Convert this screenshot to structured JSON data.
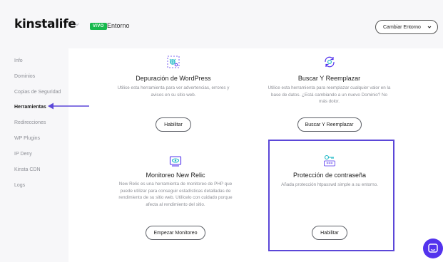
{
  "header": {
    "logo": "kinstalife",
    "env_badge": "VIVO",
    "env_label": "Entorno",
    "env_button": "Cambiar Entorno"
  },
  "sidebar": {
    "items": [
      {
        "label": "Info"
      },
      {
        "label": "Dominios"
      },
      {
        "label": "Copias de Seguridad"
      },
      {
        "label": "Herramientas",
        "active": true
      },
      {
        "label": "Redirecciones"
      },
      {
        "label": "WP Plugins"
      },
      {
        "label": "IP Deny"
      },
      {
        "label": "Kinsta CDN"
      },
      {
        "label": "Logs"
      }
    ]
  },
  "cards": [
    {
      "icon": "debug-bug-icon",
      "title": "Depuración de WordPress",
      "description": "Utilice esta herramienta para ver advertencias, errores y avisos en su sitio web.",
      "button": "Habilitar"
    },
    {
      "icon": "search-replace-icon",
      "title": "Buscar Y Reemplazar",
      "description": "Utilice esta herramienta para reemplazar cualquier valor en la base de datos. ¿Está cambiando a un nuevo Dominio? No más dolor.",
      "button": "Buscar Y Reemplazar"
    },
    {
      "icon": "monitor-eye-icon",
      "title": "Monitoreo New Relic",
      "description": "New Relic es una herramienta de monitoreo de PHP que puede utilizar para conseguir estadísticas detalladas de rendimiento de su sitio web. Utilícelo con cuidado porque afecta al rendimiento del sitio.",
      "button": "Empezar Monitoreo"
    },
    {
      "icon": "password-key-icon",
      "title": "Protección de contraseña",
      "description": "Añada protección htpasswd simple a su entorno.",
      "button": "Habilitar"
    }
  ],
  "colors": {
    "accent": "#5b47d8",
    "badge_green": "#18b94e",
    "chat": "#5333ed",
    "icon_teal": "#19b7c4",
    "icon_purple": "#5333ed"
  }
}
